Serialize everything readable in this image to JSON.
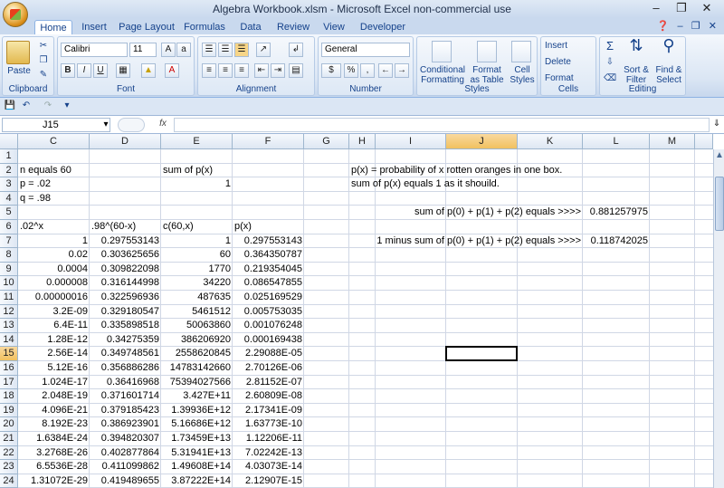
{
  "window": {
    "title": "Algebra Workbook.xlsm - Microsoft Excel non-commercial use"
  },
  "tabs": [
    "Home",
    "Insert",
    "Page Layout",
    "Formulas",
    "Data",
    "Review",
    "View",
    "Developer"
  ],
  "ribbon": {
    "clipboard": {
      "paste": "Paste",
      "label": "Clipboard"
    },
    "font": {
      "name": "Calibri",
      "size": "11",
      "bold": "B",
      "italic": "I",
      "underline": "U",
      "label": "Font"
    },
    "alignment": {
      "label": "Alignment"
    },
    "number": {
      "format": "General",
      "dollar": "$",
      "percent": "%",
      "comma": ",",
      "label": "Number"
    },
    "styles": {
      "conditional": "Conditional Formatting",
      "format_table": "Format as Table",
      "cell_styles": "Cell Styles",
      "label": "Styles"
    },
    "cells": {
      "insert": "Insert",
      "delete": "Delete",
      "format": "Format",
      "label": "Cells"
    },
    "editing": {
      "sum": "Σ",
      "sort": "Sort & Filter",
      "find": "Find & Select",
      "label": "Editing"
    }
  },
  "formula_bar": {
    "name_box": "J15",
    "fx": "fx",
    "content": ""
  },
  "columns": [
    "C",
    "D",
    "E",
    "F",
    "G",
    "H",
    "I",
    "J",
    "K",
    "L",
    "M"
  ],
  "selected": {
    "column": "J",
    "row": "15"
  },
  "rows": [
    {
      "n": "1",
      "C": "",
      "D": "",
      "E": "",
      "F": "",
      "H": "",
      "I": "",
      "L": ""
    },
    {
      "n": "2",
      "C": "n equals 60",
      "D": "",
      "E": "sum of p(x)",
      "F": "",
      "H": "p(x) = probability of x rotten oranges in one box.",
      "I": "",
      "L": ""
    },
    {
      "n": "3",
      "C": "p = .02",
      "D": "",
      "E": "1",
      "F": "",
      "H": "sum of p(x) equals 1 as it shouild.",
      "I": "",
      "L": ""
    },
    {
      "n": "4",
      "C": "q = .98",
      "D": "",
      "E": "",
      "F": "",
      "H": "",
      "I": "",
      "L": ""
    },
    {
      "n": "5",
      "C": "",
      "D": "",
      "E": "",
      "F": "",
      "H": "",
      "I": "sum of p(0) + p(1) + p(2) equals >>>>",
      "L": "0.881257975"
    },
    {
      "n": "6",
      "C": ".02^x",
      "D": ".98^(60-x)",
      "E": "c(60,x)",
      "F": "p(x)",
      "H": "",
      "I": "",
      "L": ""
    },
    {
      "n": "7",
      "C": "1",
      "D": "0.297553143",
      "E": "1",
      "F": "0.297553143",
      "H": "",
      "I": "1 minus sum of p(0) + p(1) + p(2) equals >>>>",
      "L": "0.118742025"
    },
    {
      "n": "8",
      "C": "0.02",
      "D": "0.303625656",
      "E": "60",
      "F": "0.364350787",
      "H": "",
      "I": "",
      "L": ""
    },
    {
      "n": "9",
      "C": "0.0004",
      "D": "0.309822098",
      "E": "1770",
      "F": "0.219354045",
      "H": "",
      "I": "",
      "L": ""
    },
    {
      "n": "10",
      "C": "0.000008",
      "D": "0.316144998",
      "E": "34220",
      "F": "0.086547855",
      "H": "",
      "I": "",
      "L": ""
    },
    {
      "n": "11",
      "C": "0.00000016",
      "D": "0.322596936",
      "E": "487635",
      "F": "0.025169529",
      "H": "",
      "I": "",
      "L": ""
    },
    {
      "n": "12",
      "C": "3.2E-09",
      "D": "0.329180547",
      "E": "5461512",
      "F": "0.005753035",
      "H": "",
      "I": "",
      "L": ""
    },
    {
      "n": "13",
      "C": "6.4E-11",
      "D": "0.335898518",
      "E": "50063860",
      "F": "0.001076248",
      "H": "",
      "I": "",
      "L": ""
    },
    {
      "n": "14",
      "C": "1.28E-12",
      "D": "0.34275359",
      "E": "386206920",
      "F": "0.000169438",
      "H": "",
      "I": "",
      "L": ""
    },
    {
      "n": "15",
      "C": "2.56E-14",
      "D": "0.349748561",
      "E": "2558620845",
      "F": "2.29088E-05",
      "H": "",
      "I": "",
      "L": ""
    },
    {
      "n": "16",
      "C": "5.12E-16",
      "D": "0.356886286",
      "E": "14783142660",
      "F": "2.70126E-06",
      "H": "",
      "I": "",
      "L": ""
    },
    {
      "n": "17",
      "C": "1.024E-17",
      "D": "0.36416968",
      "E": "75394027566",
      "F": "2.81152E-07",
      "H": "",
      "I": "",
      "L": ""
    },
    {
      "n": "18",
      "C": "2.048E-19",
      "D": "0.371601714",
      "E": "3.427E+11",
      "F": "2.60809E-08",
      "H": "",
      "I": "",
      "L": ""
    },
    {
      "n": "19",
      "C": "4.096E-21",
      "D": "0.379185423",
      "E": "1.39936E+12",
      "F": "2.17341E-09",
      "H": "",
      "I": "",
      "L": ""
    },
    {
      "n": "20",
      "C": "8.192E-23",
      "D": "0.386923901",
      "E": "5.16686E+12",
      "F": "1.63773E-10",
      "H": "",
      "I": "",
      "L": ""
    },
    {
      "n": "21",
      "C": "1.6384E-24",
      "D": "0.394820307",
      "E": "1.73459E+13",
      "F": "1.12206E-11",
      "H": "",
      "I": "",
      "L": ""
    },
    {
      "n": "22",
      "C": "3.2768E-26",
      "D": "0.402877864",
      "E": "5.31941E+13",
      "F": "7.02242E-13",
      "H": "",
      "I": "",
      "L": ""
    },
    {
      "n": "23",
      "C": "6.5536E-28",
      "D": "0.411099862",
      "E": "1.49608E+14",
      "F": "4.03073E-14",
      "H": "",
      "I": "",
      "L": ""
    },
    {
      "n": "24",
      "C": "1.31072E-29",
      "D": "0.419489655",
      "E": "3.87222E+14",
      "F": "2.12907E-15",
      "H": "",
      "I": "",
      "L": ""
    }
  ]
}
